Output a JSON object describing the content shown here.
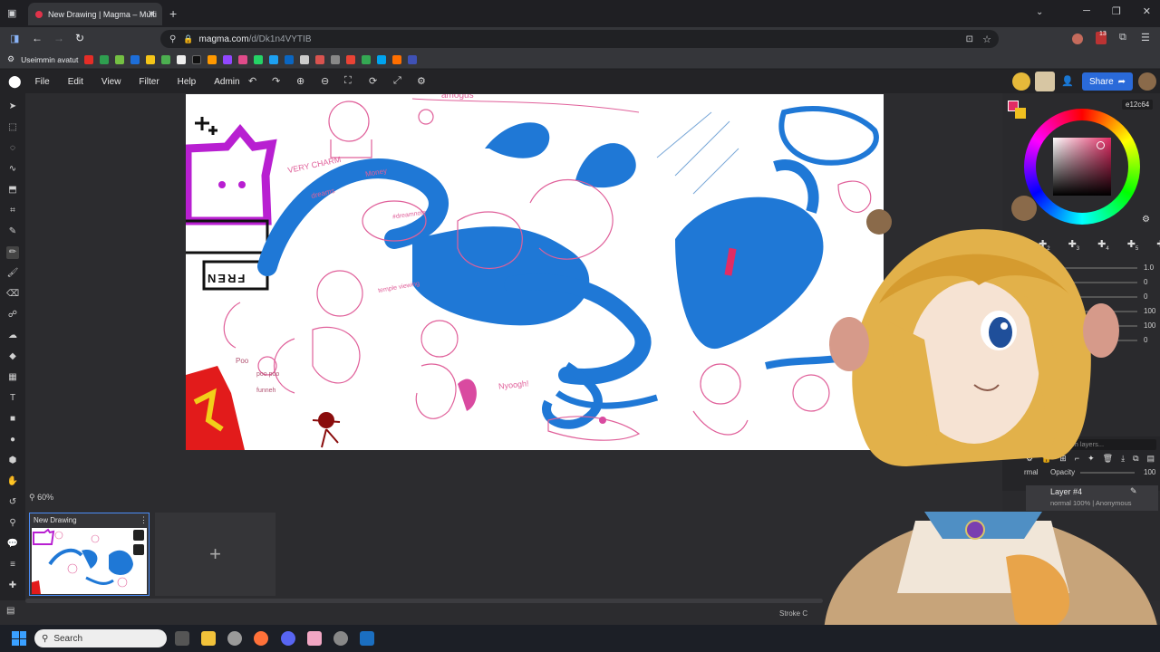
{
  "browser": {
    "tab_title": "New Drawing | Magma – Multi",
    "tab_close": "✕",
    "new_tab": "+",
    "url_main": "magma.com",
    "url_rest": "/d/Dk1n4VYTIB",
    "bookmarks_label": "Useimmin avatut",
    "notification_count": "13"
  },
  "app": {
    "menu": [
      "File",
      "Edit",
      "View",
      "Filter",
      "Help",
      "Admin"
    ],
    "share_label": "Share",
    "color_hex": "e12c64",
    "zoom_label": "60%",
    "document_title": "New Drawing",
    "new_document": "+",
    "brush_size": "1.0",
    "slider_values": [
      "0",
      "0",
      "100",
      "100",
      "0"
    ],
    "brush_slot_numbers": [
      "2",
      "3",
      "4",
      "5",
      "6"
    ],
    "layers_search_placeholder": "Search layers...",
    "opacity_label": "Opacity",
    "opacity_value": "100",
    "blend_mode": "rmal",
    "layer_name": "Layer #4",
    "layer_meta": "normal 100% | Anonymous",
    "stroke_label": "Stroke C",
    "layers_header": "rs"
  },
  "canvas_text": {
    "very_charm": "VERY CHARM",
    "money": "Money",
    "dreams": "dreams",
    "fren": "FREN",
    "poo": "Poo",
    "poo2": "poo poo",
    "funneh": "funneh",
    "nyoogh": "Nyoogh!",
    "notepad": "#dreamnote",
    "temple": "temple viewing",
    "amogus": "amogus"
  },
  "taskbar": {
    "search_label": "Search"
  },
  "colors": {
    "accent": "#2a6ad9",
    "primary_color": "#e12c64",
    "secondary_color": "#f0c020"
  }
}
